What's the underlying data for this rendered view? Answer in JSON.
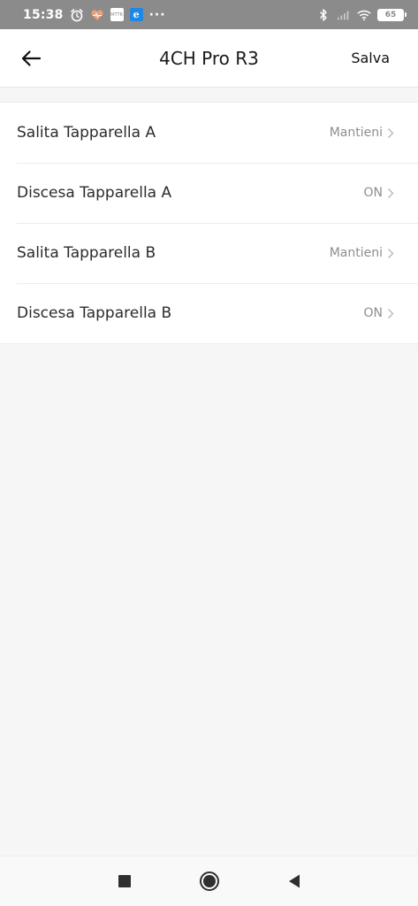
{
  "status_bar": {
    "time": "15:38",
    "small_badge_text": "MTTR",
    "battery_level": "65",
    "icons": [
      "alarm-icon",
      "health-heart-icon",
      "app-badge-icon",
      "edge-browser-icon",
      "more-dots-icon",
      "bluetooth-icon",
      "signal-icon",
      "wifi-icon",
      "battery-icon"
    ]
  },
  "header": {
    "title": "4CH Pro R3",
    "save_label": "Salva",
    "back_icon": "arrow-left-icon"
  },
  "settings": {
    "items": [
      {
        "label": "Salita Tapparella A",
        "value": "Mantieni"
      },
      {
        "label": "Discesa Tapparella A",
        "value": "ON"
      },
      {
        "label": "Salita Tapparella B",
        "value": "Mantieni"
      },
      {
        "label": "Discesa Tapparella B",
        "value": "ON"
      }
    ]
  },
  "nav_bar": {
    "icons": [
      "recents-square-icon",
      "home-circle-icon",
      "back-triangle-icon"
    ]
  },
  "colors": {
    "status_bar_bg": "#8b8b8b",
    "page_bg": "#f6f6f6",
    "card_bg": "#ffffff",
    "value_text": "#8e8e8e",
    "label_text": "#2b2b2b"
  }
}
